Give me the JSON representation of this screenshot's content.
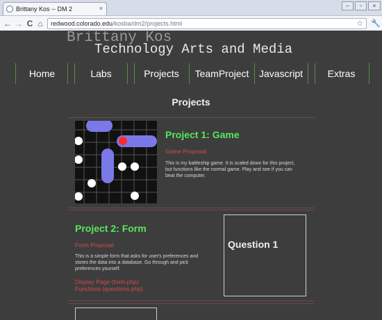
{
  "browser": {
    "tab_title": "Brittany Kos -- DM 2",
    "tab_close": "×",
    "url_host": "redwood.colorado.edu",
    "url_path": "/kosba/dm2/projects.html",
    "back_glyph": "←",
    "forward_glyph": "→",
    "reload_glyph": "C",
    "home_glyph": "⌂",
    "star_glyph": "☆",
    "wrench_glyph": "🔧",
    "minimize_glyph": "–",
    "restore_glyph": "▫",
    "close_glyph": "×"
  },
  "header": {
    "name": "Brittany Kos",
    "subtitle": "Technology Arts and Media"
  },
  "nav": {
    "items": [
      "Home",
      "Labs",
      "Projects",
      "TeamProject",
      "Javascript",
      "Extras"
    ]
  },
  "main": {
    "section_title": "Projects",
    "project1": {
      "title": "Project 1: Game",
      "link": "Game Proposal",
      "desc_lines": [
        "This is my battleship game. It is scaled down for this project,",
        "but functions like the normal game. Play and see if you can",
        "beat the computer."
      ]
    },
    "project2": {
      "title": "Project 2: Form",
      "link": "Form Proposal",
      "desc_lines": [
        "This is a simple form that asks for user's preferences and",
        "stores the data into a database. Go through and pick",
        "preferences yourself."
      ],
      "link2": "Display Page (form.php)",
      "link3": "Functions (questions.php)",
      "preview_text": "Question 1"
    }
  },
  "colors": {
    "background": "#3d3d3d",
    "accent_green": "#57e85a",
    "link_red": "#d94a4a",
    "ship_purple": "#7b78e8"
  }
}
